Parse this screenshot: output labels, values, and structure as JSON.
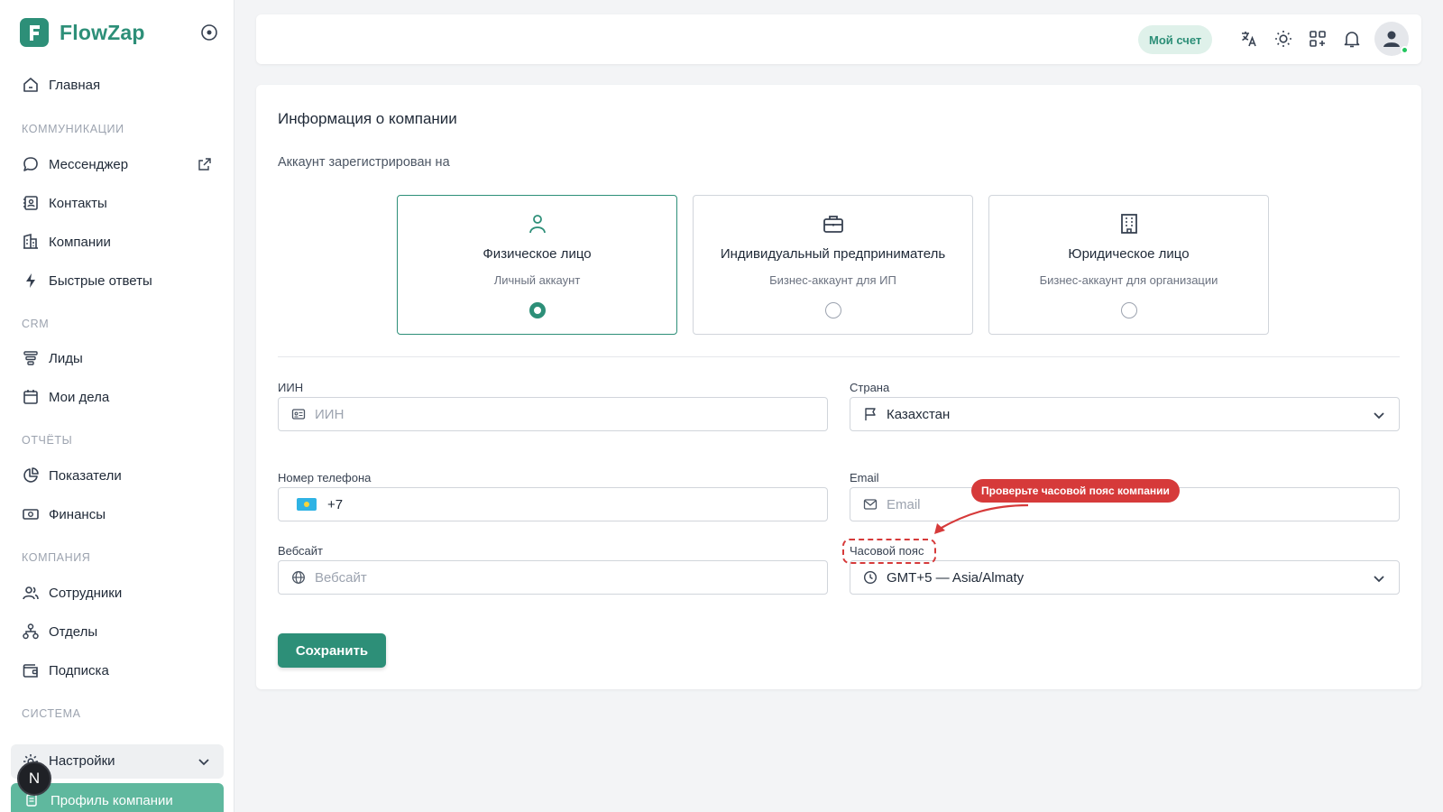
{
  "brand": {
    "name": "FlowZap"
  },
  "sidebar": {
    "home": "Главная",
    "sections": {
      "communications": "КОММУНИКАЦИИ",
      "crm": "CRM",
      "reports": "ОТЧЁТЫ",
      "company": "КОМПАНИЯ",
      "system": "СИСТЕМА"
    },
    "items": {
      "messenger": "Мессенджер",
      "contacts": "Контакты",
      "companies": "Компании",
      "quick_replies": "Быстрые ответы",
      "leads": "Лиды",
      "tasks": "Мои дела",
      "metrics": "Показатели",
      "finance": "Финансы",
      "employees": "Сотрудники",
      "departments": "Отделы",
      "subscription": "Подписка",
      "settings": "Настройки",
      "company_profile": "Профиль компании"
    },
    "user_badge": "N"
  },
  "header": {
    "account": "Мой счет"
  },
  "card": {
    "title": "Информация о компании",
    "registered_label": "Аккаунт зарегистрирован на",
    "options": [
      {
        "title": "Физическое лицо",
        "subtitle": "Личный аккаунт",
        "selected": true
      },
      {
        "title": "Индивидуальный предприниматель",
        "subtitle": "Бизнес-аккаунт для ИП",
        "selected": false
      },
      {
        "title": "Юридическое лицо",
        "subtitle": "Бизнес-аккаунт для организации",
        "selected": false
      }
    ],
    "fields": {
      "iin": {
        "label": "ИИН",
        "placeholder": "ИИН"
      },
      "country": {
        "label": "Страна",
        "value": "Казахстан"
      },
      "phone": {
        "label": "Номер телефона",
        "value": "+7"
      },
      "email": {
        "label": "Email",
        "placeholder": "Email"
      },
      "website": {
        "label": "Вебсайт",
        "placeholder": "Вебсайт"
      },
      "timezone": {
        "label": "Часовой пояс",
        "value": "GMT+5 — Asia/Almaty"
      }
    },
    "save": "Сохранить"
  },
  "annotation": {
    "text": "Проверьте часовой пояс компании",
    "color": "#d63a3a"
  },
  "colors": {
    "accent": "#2d8f78",
    "active_nav": "#5fb89e"
  }
}
